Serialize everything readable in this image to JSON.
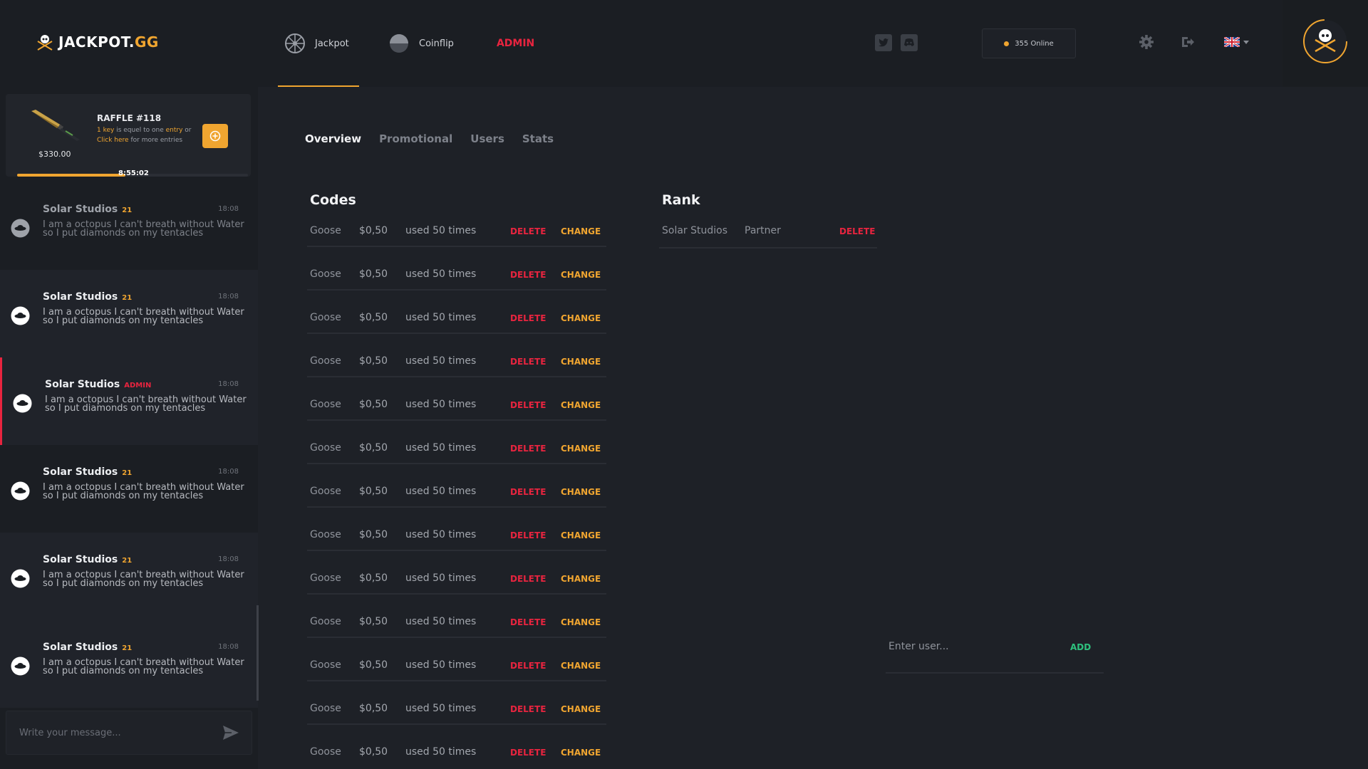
{
  "header": {
    "logo_text": "JACKPOT.",
    "logo_suffix": "GG",
    "nav": [
      {
        "label": "Jackpot",
        "icon": "roulette-wheel-icon",
        "active": true
      },
      {
        "label": "Coinflip",
        "icon": "coin-icon"
      },
      {
        "label": "ADMIN"
      }
    ],
    "online": "355 Online",
    "accent_color": "#f0a530",
    "danger_color": "#e8243f"
  },
  "raffle": {
    "price": "$330.00",
    "title": "RAFFLE #118",
    "line1_a": "1 key",
    "line1_b": " is equel to one ",
    "line1_c": "entry",
    "line1_d": "  or",
    "line2_a": "Click here",
    "line2_b": " for more entries",
    "timer": "8:55:02",
    "progress": 0.47
  },
  "chat": {
    "messages": [
      {
        "name": "Solar Studios",
        "badge": "21",
        "time": "18:08",
        "text": "I am a octopus I can't breath without Water so I put diamonds on my tentacles"
      },
      {
        "name": "Solar Studios",
        "badge": "21",
        "time": "18:08",
        "text": "I am a octopus I can't breath without Water so I put diamonds on my tentacles"
      },
      {
        "name": "Solar Studios",
        "badge": "ADMIN",
        "time": "18:08",
        "text": "I am a octopus I can't breath without Water so I put diamonds on my tentacles"
      },
      {
        "name": "Solar Studios",
        "badge": "21",
        "time": "18:08",
        "text": "I am a octopus I can't breath without Water so I put diamonds on my tentacles"
      },
      {
        "name": "Solar Studios",
        "badge": "21",
        "time": "18:08",
        "text": "I am a octopus I can't breath without Water so I put diamonds on my tentacles"
      },
      {
        "name": "Solar Studios",
        "badge": "21",
        "time": "18:08",
        "text": "I am a octopus I can't breath without Water so I put diamonds on my tentacles"
      }
    ],
    "placeholder": "Write your message..."
  },
  "tabs": [
    "Overview",
    "Promotional",
    "Users",
    "Stats"
  ],
  "codes": {
    "title": "Codes",
    "delete_label": "DELETE",
    "change_label": "CHANGE",
    "rows": [
      {
        "name": "Goose",
        "value": "$0,50",
        "used": "used 50 times"
      },
      {
        "name": "Goose",
        "value": "$0,50",
        "used": "used 50 times"
      },
      {
        "name": "Goose",
        "value": "$0,50",
        "used": "used 50 times"
      },
      {
        "name": "Goose",
        "value": "$0,50",
        "used": "used 50 times"
      },
      {
        "name": "Goose",
        "value": "$0,50",
        "used": "used 50 times"
      },
      {
        "name": "Goose",
        "value": "$0,50",
        "used": "used 50 times"
      },
      {
        "name": "Goose",
        "value": "$0,50",
        "used": "used 50 times"
      },
      {
        "name": "Goose",
        "value": "$0,50",
        "used": "used 50 times"
      },
      {
        "name": "Goose",
        "value": "$0,50",
        "used": "used 50 times"
      },
      {
        "name": "Goose",
        "value": "$0,50",
        "used": "used 50 times"
      },
      {
        "name": "Goose",
        "value": "$0,50",
        "used": "used 50 times"
      },
      {
        "name": "Goose",
        "value": "$0,50",
        "used": "used 50 times"
      },
      {
        "name": "Goose",
        "value": "$0,50",
        "used": "used 50 times"
      }
    ]
  },
  "rank": {
    "title": "Rank",
    "rows": [
      {
        "name": "Solar Studios",
        "role": "Partner",
        "delete": "DELETE"
      }
    ],
    "add_placeholder": "Enter user...",
    "add_label": "ADD"
  }
}
